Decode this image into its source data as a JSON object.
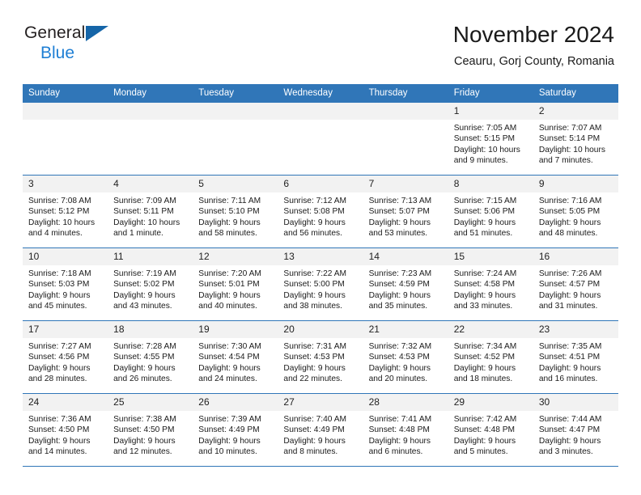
{
  "brand": {
    "line1": "General",
    "line2": "Blue",
    "logo_icon": "triangle-logo-icon"
  },
  "header": {
    "title": "November 2024",
    "subtitle": "Ceauru, Gorj County, Romania"
  },
  "calendar": {
    "weekday_headers": [
      "Sunday",
      "Monday",
      "Tuesday",
      "Wednesday",
      "Thursday",
      "Friday",
      "Saturday"
    ],
    "colors": {
      "header_blue": "#3076B8",
      "daynum_gray": "#F2F2F2",
      "brand_blue": "#1F7FD4",
      "logo_blue": "#1565A8"
    },
    "labels": {
      "sunrise": "Sunrise:",
      "sunset": "Sunset:",
      "daylight": "Daylight:"
    },
    "weeks": [
      [
        {
          "day": "",
          "empty": true
        },
        {
          "day": "",
          "empty": true
        },
        {
          "day": "",
          "empty": true
        },
        {
          "day": "",
          "empty": true
        },
        {
          "day": "",
          "empty": true
        },
        {
          "day": "1",
          "sunrise": "Sunrise: 7:05 AM",
          "sunset": "Sunset: 5:15 PM",
          "daylight1": "Daylight: 10 hours",
          "daylight2": "and 9 minutes."
        },
        {
          "day": "2",
          "sunrise": "Sunrise: 7:07 AM",
          "sunset": "Sunset: 5:14 PM",
          "daylight1": "Daylight: 10 hours",
          "daylight2": "and 7 minutes."
        }
      ],
      [
        {
          "day": "3",
          "sunrise": "Sunrise: 7:08 AM",
          "sunset": "Sunset: 5:12 PM",
          "daylight1": "Daylight: 10 hours",
          "daylight2": "and 4 minutes."
        },
        {
          "day": "4",
          "sunrise": "Sunrise: 7:09 AM",
          "sunset": "Sunset: 5:11 PM",
          "daylight1": "Daylight: 10 hours",
          "daylight2": "and 1 minute."
        },
        {
          "day": "5",
          "sunrise": "Sunrise: 7:11 AM",
          "sunset": "Sunset: 5:10 PM",
          "daylight1": "Daylight: 9 hours",
          "daylight2": "and 58 minutes."
        },
        {
          "day": "6",
          "sunrise": "Sunrise: 7:12 AM",
          "sunset": "Sunset: 5:08 PM",
          "daylight1": "Daylight: 9 hours",
          "daylight2": "and 56 minutes."
        },
        {
          "day": "7",
          "sunrise": "Sunrise: 7:13 AM",
          "sunset": "Sunset: 5:07 PM",
          "daylight1": "Daylight: 9 hours",
          "daylight2": "and 53 minutes."
        },
        {
          "day": "8",
          "sunrise": "Sunrise: 7:15 AM",
          "sunset": "Sunset: 5:06 PM",
          "daylight1": "Daylight: 9 hours",
          "daylight2": "and 51 minutes."
        },
        {
          "day": "9",
          "sunrise": "Sunrise: 7:16 AM",
          "sunset": "Sunset: 5:05 PM",
          "daylight1": "Daylight: 9 hours",
          "daylight2": "and 48 minutes."
        }
      ],
      [
        {
          "day": "10",
          "sunrise": "Sunrise: 7:18 AM",
          "sunset": "Sunset: 5:03 PM",
          "daylight1": "Daylight: 9 hours",
          "daylight2": "and 45 minutes."
        },
        {
          "day": "11",
          "sunrise": "Sunrise: 7:19 AM",
          "sunset": "Sunset: 5:02 PM",
          "daylight1": "Daylight: 9 hours",
          "daylight2": "and 43 minutes."
        },
        {
          "day": "12",
          "sunrise": "Sunrise: 7:20 AM",
          "sunset": "Sunset: 5:01 PM",
          "daylight1": "Daylight: 9 hours",
          "daylight2": "and 40 minutes."
        },
        {
          "day": "13",
          "sunrise": "Sunrise: 7:22 AM",
          "sunset": "Sunset: 5:00 PM",
          "daylight1": "Daylight: 9 hours",
          "daylight2": "and 38 minutes."
        },
        {
          "day": "14",
          "sunrise": "Sunrise: 7:23 AM",
          "sunset": "Sunset: 4:59 PM",
          "daylight1": "Daylight: 9 hours",
          "daylight2": "and 35 minutes."
        },
        {
          "day": "15",
          "sunrise": "Sunrise: 7:24 AM",
          "sunset": "Sunset: 4:58 PM",
          "daylight1": "Daylight: 9 hours",
          "daylight2": "and 33 minutes."
        },
        {
          "day": "16",
          "sunrise": "Sunrise: 7:26 AM",
          "sunset": "Sunset: 4:57 PM",
          "daylight1": "Daylight: 9 hours",
          "daylight2": "and 31 minutes."
        }
      ],
      [
        {
          "day": "17",
          "sunrise": "Sunrise: 7:27 AM",
          "sunset": "Sunset: 4:56 PM",
          "daylight1": "Daylight: 9 hours",
          "daylight2": "and 28 minutes."
        },
        {
          "day": "18",
          "sunrise": "Sunrise: 7:28 AM",
          "sunset": "Sunset: 4:55 PM",
          "daylight1": "Daylight: 9 hours",
          "daylight2": "and 26 minutes."
        },
        {
          "day": "19",
          "sunrise": "Sunrise: 7:30 AM",
          "sunset": "Sunset: 4:54 PM",
          "daylight1": "Daylight: 9 hours",
          "daylight2": "and 24 minutes."
        },
        {
          "day": "20",
          "sunrise": "Sunrise: 7:31 AM",
          "sunset": "Sunset: 4:53 PM",
          "daylight1": "Daylight: 9 hours",
          "daylight2": "and 22 minutes."
        },
        {
          "day": "21",
          "sunrise": "Sunrise: 7:32 AM",
          "sunset": "Sunset: 4:53 PM",
          "daylight1": "Daylight: 9 hours",
          "daylight2": "and 20 minutes."
        },
        {
          "day": "22",
          "sunrise": "Sunrise: 7:34 AM",
          "sunset": "Sunset: 4:52 PM",
          "daylight1": "Daylight: 9 hours",
          "daylight2": "and 18 minutes."
        },
        {
          "day": "23",
          "sunrise": "Sunrise: 7:35 AM",
          "sunset": "Sunset: 4:51 PM",
          "daylight1": "Daylight: 9 hours",
          "daylight2": "and 16 minutes."
        }
      ],
      [
        {
          "day": "24",
          "sunrise": "Sunrise: 7:36 AM",
          "sunset": "Sunset: 4:50 PM",
          "daylight1": "Daylight: 9 hours",
          "daylight2": "and 14 minutes."
        },
        {
          "day": "25",
          "sunrise": "Sunrise: 7:38 AM",
          "sunset": "Sunset: 4:50 PM",
          "daylight1": "Daylight: 9 hours",
          "daylight2": "and 12 minutes."
        },
        {
          "day": "26",
          "sunrise": "Sunrise: 7:39 AM",
          "sunset": "Sunset: 4:49 PM",
          "daylight1": "Daylight: 9 hours",
          "daylight2": "and 10 minutes."
        },
        {
          "day": "27",
          "sunrise": "Sunrise: 7:40 AM",
          "sunset": "Sunset: 4:49 PM",
          "daylight1": "Daylight: 9 hours",
          "daylight2": "and 8 minutes."
        },
        {
          "day": "28",
          "sunrise": "Sunrise: 7:41 AM",
          "sunset": "Sunset: 4:48 PM",
          "daylight1": "Daylight: 9 hours",
          "daylight2": "and 6 minutes."
        },
        {
          "day": "29",
          "sunrise": "Sunrise: 7:42 AM",
          "sunset": "Sunset: 4:48 PM",
          "daylight1": "Daylight: 9 hours",
          "daylight2": "and 5 minutes."
        },
        {
          "day": "30",
          "sunrise": "Sunrise: 7:44 AM",
          "sunset": "Sunset: 4:47 PM",
          "daylight1": "Daylight: 9 hours",
          "daylight2": "and 3 minutes."
        }
      ]
    ]
  }
}
